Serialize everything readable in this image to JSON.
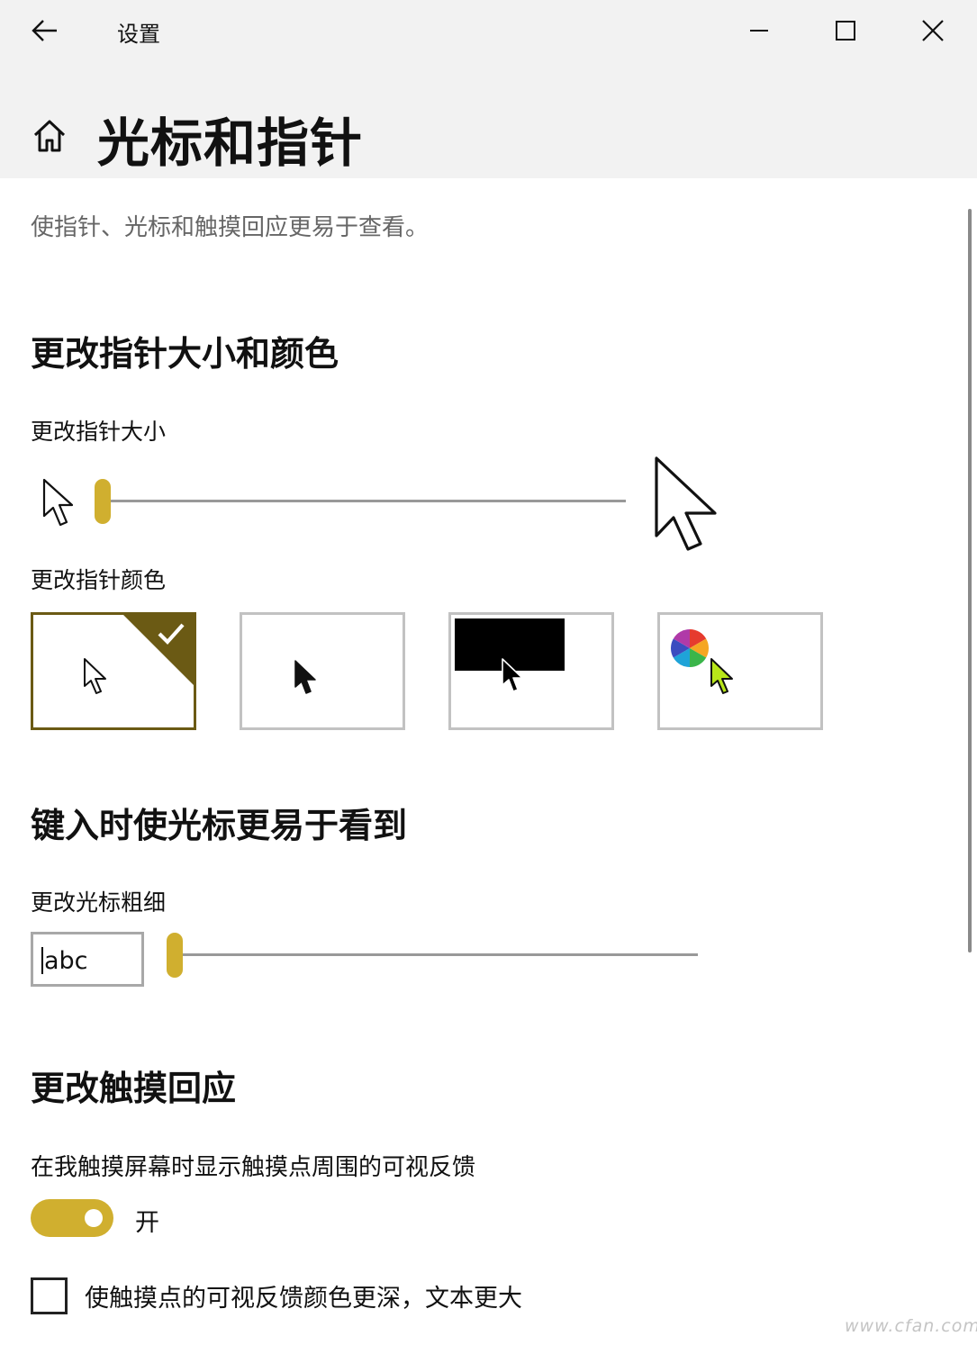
{
  "window": {
    "title": "设置",
    "back_icon": "arrow-left",
    "minimize_icon": "minimize",
    "maximize_icon": "maximize",
    "close_icon": "close"
  },
  "header": {
    "home_icon": "home",
    "title": "光标和指针"
  },
  "description": "使指针、光标和触摸回应更易于查看。",
  "pointer_section": {
    "heading": "更改指针大小和颜色",
    "size_label": "更改指针大小",
    "size_slider_value": 0,
    "color_label": "更改指针颜色",
    "color_options": [
      {
        "name": "white",
        "selected": true
      },
      {
        "name": "black",
        "selected": false
      },
      {
        "name": "inverted",
        "selected": false
      },
      {
        "name": "custom",
        "selected": false
      }
    ]
  },
  "cursor_section": {
    "heading": "键入时使光标更易于看到",
    "thickness_label": "更改光标粗细",
    "preview_text": "abc",
    "thickness_slider_value": 0
  },
  "touch_section": {
    "heading": "更改触摸回应",
    "feedback_label": "在我触摸屏幕时显示触摸点周围的可视反馈",
    "toggle_on": true,
    "toggle_state_label": "开",
    "darker_checkbox_checked": false,
    "darker_checkbox_label": "使触摸点的可视反馈颜色更深，文本更大"
  },
  "watermark": "www.cfan.com.cn",
  "colors": {
    "accent": "#d0af2f",
    "selected_border": "#6b5a14",
    "custom_pointer": "#b8e619",
    "titlebar_bg": "#f2f2f2"
  }
}
